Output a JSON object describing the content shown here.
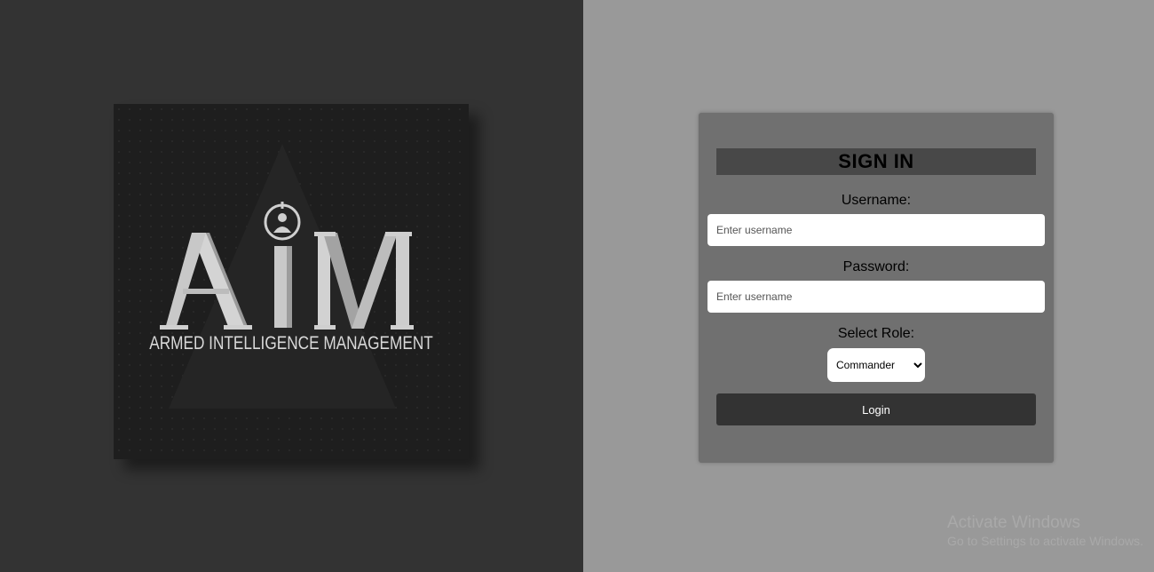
{
  "logo": {
    "letters": [
      "A",
      "i",
      "M"
    ],
    "subtitle": "ARMED INTELLIGENCE MANAGEMENT",
    "icon": "target-person-icon"
  },
  "signin": {
    "title": "SIGN IN",
    "username_label": "Username:",
    "username_placeholder": "Enter username",
    "username_value": "",
    "password_label": "Password:",
    "password_placeholder": "Enter username",
    "password_value": "",
    "role_label": "Select Role:",
    "role_selected": "Commander",
    "login_label": "Login"
  },
  "watermark": {
    "title": "Activate Windows",
    "subtitle": "Go to Settings to activate Windows."
  },
  "colors": {
    "left_bg": "#333333",
    "right_bg": "#999999",
    "card_bg": "#707070",
    "title_bar": "#484848",
    "button_bg": "#333333"
  }
}
